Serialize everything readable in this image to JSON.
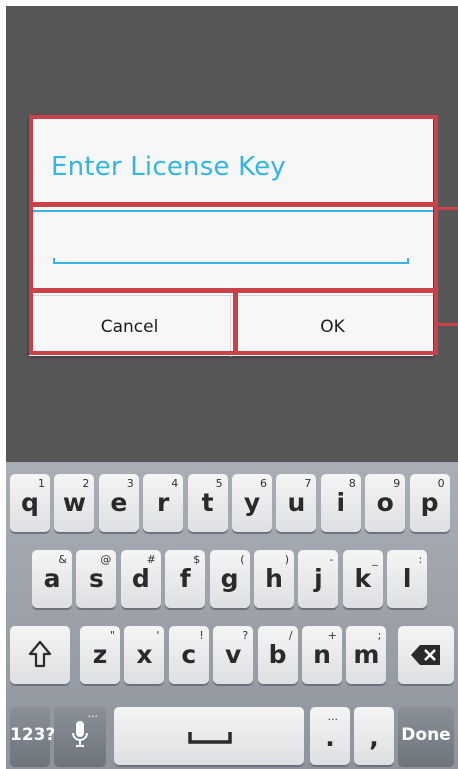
{
  "dialog": {
    "title": "Enter License Key",
    "input_value": "",
    "cancel_label": "Cancel",
    "ok_label": "OK"
  },
  "colors": {
    "accent": "#33b5e5",
    "highlight": "#c9424a",
    "background": "#575757"
  },
  "keyboard": {
    "row1": [
      {
        "main": "q",
        "sub": "1"
      },
      {
        "main": "w",
        "sub": "2"
      },
      {
        "main": "e",
        "sub": "3"
      },
      {
        "main": "r",
        "sub": "4"
      },
      {
        "main": "t",
        "sub": "5"
      },
      {
        "main": "y",
        "sub": "6"
      },
      {
        "main": "u",
        "sub": "7"
      },
      {
        "main": "i",
        "sub": "8"
      },
      {
        "main": "o",
        "sub": "9"
      },
      {
        "main": "p",
        "sub": "0"
      }
    ],
    "row2": [
      {
        "main": "a",
        "sub": "&"
      },
      {
        "main": "s",
        "sub": "@"
      },
      {
        "main": "d",
        "sub": "#"
      },
      {
        "main": "f",
        "sub": "$"
      },
      {
        "main": "g",
        "sub": "("
      },
      {
        "main": "h",
        "sub": ")"
      },
      {
        "main": "j",
        "sub": "-"
      },
      {
        "main": "k",
        "sub": "_"
      },
      {
        "main": "l",
        "sub": ":"
      }
    ],
    "row3": [
      {
        "main": "z",
        "sub": "\""
      },
      {
        "main": "x",
        "sub": "'"
      },
      {
        "main": "c",
        "sub": "!"
      },
      {
        "main": "v",
        "sub": "?"
      },
      {
        "main": "b",
        "sub": "/"
      },
      {
        "main": "n",
        "sub": "+"
      },
      {
        "main": "m",
        "sub": ";"
      }
    ],
    "shift_icon": "shift-arrow-icon",
    "backspace_icon": "backspace-icon",
    "mic_icon": "microphone-icon",
    "symbols_label": "123?",
    "space_glyph": "␣",
    "period_label": ".",
    "period_sub": "...",
    "comma_label": ",",
    "done_label": "Done"
  }
}
